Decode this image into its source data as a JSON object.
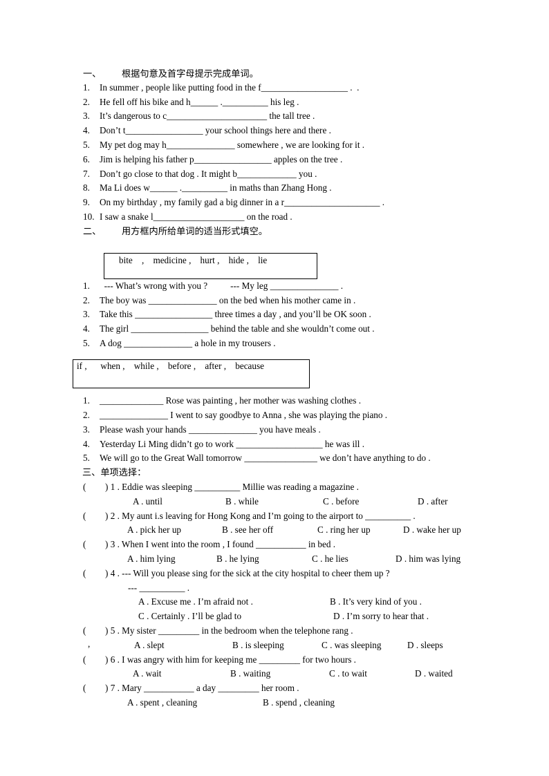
{
  "section1": {
    "num": "一、",
    "title": "根据句意及首字母提示完成单词。",
    "items": [
      {
        "n": "1.",
        "text": "In summer , people like putting food in the f___________________ .  ."
      },
      {
        "n": "2.",
        "text": "He fell off his bike and h______ .__________ his leg ."
      },
      {
        "n": "3.",
        "text": "It’s dangerous to c______________________ the tall tree ."
      },
      {
        "n": "4.",
        "text": "Don’t t_________________ your school things here and there ."
      },
      {
        "n": "5.",
        "text": "My pet dog may h_______________ somewhere , we are looking for it ."
      },
      {
        "n": "6.",
        "text": "Jim is helping his father p_________________ apples on the tree ."
      },
      {
        "n": "7.",
        "text": "Don’t go close to that dog . It might b_____________ you ."
      },
      {
        "n": "8.",
        "text": "Ma Li does w______ .__________ in maths than Zhang Hong ."
      },
      {
        "n": "9.",
        "text": "On my birthday , my family gad a big dinner in a r_____________________ ."
      },
      {
        "n": "10.",
        "text": "I saw a snake l____________________ on the road ."
      }
    ]
  },
  "section2": {
    "num": "二、",
    "title": "用方框内所给单词的适当形式填空。",
    "box1": "bite    ,    medicine ,    hurt ,    hide ,    lie",
    "items1": [
      {
        "n": "1.",
        "text": "  --- What’s wrong with you ?          --- My leg _______________ ."
      },
      {
        "n": "2.",
        "text": "The boy was _______________ on the bed when his mother came in ."
      },
      {
        "n": "3.",
        "text": "Take this _________________ three times a day , and you’ll be OK soon ."
      },
      {
        "n": "4.",
        "text": "The girl _________________ behind the table and she wouldn’t come out ."
      },
      {
        "n": "5.",
        "text": "A dog _______________ a hole in my trousers ."
      }
    ],
    "box2": "if ,      when ,    while ,    before ,    after ,    because",
    "items2": [
      {
        "n": "1.",
        "text": "______________ Rose was painting , her mother was washing clothes ."
      },
      {
        "n": "2.",
        "text": "_______________ I went to say goodbye to Anna , she was playing the piano ."
      },
      {
        "n": "3.",
        "text": "Please wash your hands _______________ you have meals ."
      },
      {
        "n": "4.",
        "text": "Yesterday Li Ming didn’t go to work ___________________ he was ill ."
      },
      {
        "n": "5.",
        "text": "We will go to the Great Wall tomorrow ________________ we don’t have anything to do ."
      }
    ]
  },
  "section3": {
    "title": "三、单项选择：",
    "questions": [
      {
        "q": ") 1 . Eddie was sleeping __________ Millie was reading a magazine .",
        "options": [
          "A . until",
          "B . while",
          "C . before",
          "D . after"
        ]
      },
      {
        "q": ") 2 . My aunt i.s leaving for Hong Kong and I’m going to the airport to __________ .",
        "options": [
          "A . pick her up",
          "B . see her off",
          "C . ring her up",
          "D . wake her up"
        ]
      },
      {
        "q": ") 3 . When I went into the room , I found ___________ in bed .",
        "options": [
          "A . him lying",
          "B . he lying",
          "C . he lies",
          "D . him was lying"
        ]
      },
      {
        "q": ") 4 . --- Will you please sing for the sick at the city hospital to cheer them up ?",
        "answer": "--- __________ .",
        "options": [
          "A . Excuse me . I’m afraid not .",
          "B . It’s very kind of you .",
          "C . Certainly . I’ll be glad to",
          "D . I’m sorry to hear that ."
        ]
      },
      {
        "q": ") 5 . My sister _________ in the bedroom when the telephone rang .",
        "options": [
          "A . slept",
          "B . is sleeping",
          "C . was sleeping",
          "D . sleeps"
        ]
      },
      {
        "q": ") 6 . I was angry with him for keeping me _________ for two hours .",
        "options": [
          "A . wait",
          "B . waiting",
          "C . to wait",
          "D . waited"
        ]
      },
      {
        "q": ") 7 . Mary ___________ a day _________ her room .",
        "options": [
          "A . spent , cleaning",
          "B . spend , cleaning"
        ]
      }
    ],
    "paren": "(",
    "stray_mark": ","
  }
}
